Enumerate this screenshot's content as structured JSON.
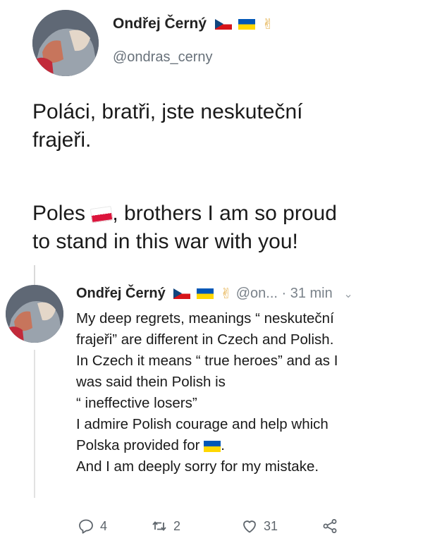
{
  "tweet": {
    "author_name": "Ondřej Černý",
    "handle": "@ondras_cerny",
    "text_line_1": "Poláci, bratři, jste neskuteční",
    "text_line_2": "frajeři.",
    "text_line_3_prefix": "Poles",
    "text_line_3_suffix": ", brothers I am so proud",
    "text_line_4": "to stand in this war with you!",
    "name_emojis": [
      "czech-flag-icon",
      "ukraine-flag-icon",
      "victory-hand-icon"
    ]
  },
  "reply": {
    "author_name": "Ondřej Černý",
    "handle_truncated": "@on...",
    "time": "· 31 min",
    "lines": [
      "My deep regrets, meanings “ neskuteční",
      "frajeři” are different in Czech and Polish.",
      "In Czech it means “ true heroes” and as I",
      "was said thein Polish is",
      "“ ineffective losers”",
      "I admire Polish courage and help which"
    ],
    "line_7_prefix": "Polska provided for",
    "line_7_suffix": ".",
    "line_8": "And I am deeply sorry for my mistake.",
    "counts": {
      "replies": "4",
      "retweets": "2",
      "likes": "31"
    }
  },
  "colors": {
    "text": "#1a1a1a",
    "secondary": "#68717a",
    "ukraine_blue": "#0057b7",
    "ukraine_yellow": "#ffd700",
    "czech_blue": "#11457e",
    "flag_red": "#dc143c"
  }
}
